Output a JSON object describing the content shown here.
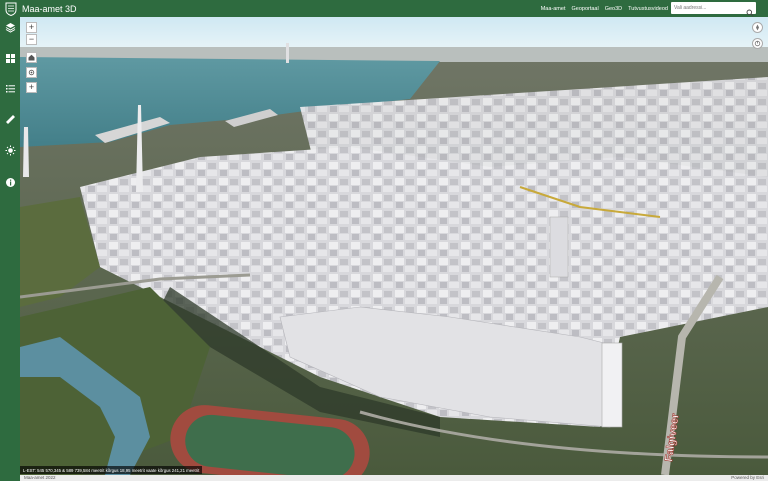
{
  "header": {
    "title": "Maa-amet 3D",
    "links": [
      "Maa-amet",
      "Geoportaal",
      "Geo3D",
      "Tutvustusvideod"
    ],
    "search_placeholder": "Vali aadressi..."
  },
  "sidebar": {
    "items": [
      "layers-icon",
      "grid-icon",
      "list-icon",
      "ruler-icon",
      "sun-icon",
      "info-icon"
    ]
  },
  "map_controls": {
    "zoom_in": "+",
    "zoom_out": "−",
    "add": "+"
  },
  "map_labels": {
    "street": "Falgiveer"
  },
  "status": {
    "coordinates": "L-EST: 545 570,345 & 589 739,584 meetrit  kõrgus 18,95 meetrit  vaate kõrgus 241,21 meetrit"
  },
  "footer": {
    "copyright": "Maa-amet 2022",
    "powered": "Powered by Esri"
  },
  "colors": {
    "brand_green": "#2e6b3f",
    "sea": "#4e8a95",
    "sky": "#d7eef7"
  }
}
